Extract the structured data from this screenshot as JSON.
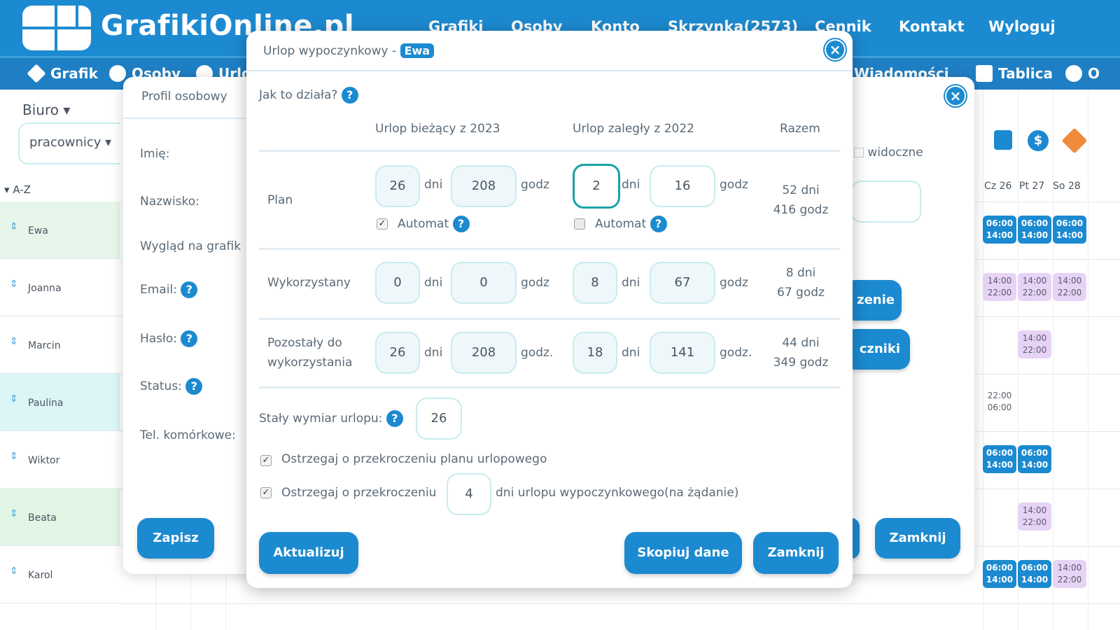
{
  "app": {
    "logo_text": "GrafikiOnline.pl"
  },
  "topnav": [
    "Grafiki",
    "Osoby",
    "Konto",
    "Skrzynka(2573)",
    "Cennik",
    "Kontakt",
    "Wyloguj"
  ],
  "subnav": {
    "grafik": "Grafik",
    "osoby": "Osoby",
    "urlopy": "Urlo",
    "wiadomosci": "Wiadomości",
    "tablica": "Tablica",
    "opcje": "O"
  },
  "background": {
    "office": "Biuro",
    "workers_select": "pracownicy",
    "sort_label": "A-Z",
    "employees": [
      "Ewa",
      "Joanna",
      "Marcin",
      "Paulina",
      "Wiktor",
      "Beata",
      "Karol"
    ],
    "day_headers": [
      "Cz 26",
      "Pt 27",
      "So 28"
    ],
    "visible_label": "widoczne",
    "partial_btn1": "zenie",
    "partial_btn2": "czniki",
    "close_btn": "Zamknij",
    "shift_times": {
      "a": "06:00",
      "b": "14:00",
      "c": "22:00"
    }
  },
  "profile": {
    "title": "Profil osobowy",
    "fields": [
      "Imię:",
      "Nazwisko:",
      "Wygląd na grafik",
      "Email:",
      "Hasło:",
      "Status:",
      "Tel. komórkowe:"
    ],
    "save_button": "Zapisz"
  },
  "vacation": {
    "title": "Urlop wypoczynkowy -",
    "person": "Ewa",
    "how_it_works": "Jak to działa?",
    "col_current": "Urlop bieżący z 2023",
    "col_overdue": "Urlop zaległy z 2022",
    "col_total": "Razem",
    "unit_days": "dni",
    "unit_hours": "godz",
    "unit_hours_dot": "godz.",
    "automat": "Automat",
    "rows": {
      "plan": {
        "label": "Plan",
        "cur_days": "26",
        "cur_hours": "208",
        "ov_days": "2",
        "ov_hours": "16",
        "total_days": "52 dni",
        "total_hours": "416 godz"
      },
      "used": {
        "label": "Wykorzystany",
        "cur_days": "0",
        "cur_hours": "0",
        "ov_days": "8",
        "ov_hours": "67",
        "total_days": "8 dni",
        "total_hours": "67 godz"
      },
      "left": {
        "label1": "Pozostały do",
        "label2": "wykorzystania",
        "cur_days": "26",
        "cur_hours": "208",
        "ov_days": "18",
        "ov_hours": "141",
        "total_days": "44 dni",
        "total_hours": "349 godz"
      }
    },
    "fixed_label": "Stały wymiar urlopu:",
    "fixed_value": "26",
    "warn1": "Ostrzegaj o przekroczeniu planu urlopowego",
    "warn2_a": "Ostrzegaj o przekroczeniu",
    "warn2_value": "4",
    "warn2_b": "dni urlopu wypoczynkowego(na żądanie)",
    "btn_update": "Aktualizuj",
    "btn_copy": "Skopiuj dane",
    "btn_close": "Zamknij"
  }
}
